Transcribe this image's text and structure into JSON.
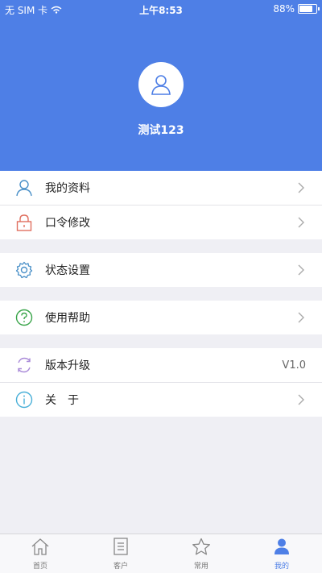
{
  "status_bar": {
    "carrier": "无 SIM 卡",
    "time": "上午8:53",
    "battery": "88%",
    "battery_level": 0.88
  },
  "profile": {
    "name": "测试123"
  },
  "menu": {
    "profile_label": "我的资料",
    "password_label": "口令修改",
    "status_label": "状态设置",
    "help_label": "使用帮助",
    "upgrade_label": "版本升级",
    "upgrade_value": "V1.0",
    "about_label": "关　于"
  },
  "tabs": [
    {
      "label": "首页",
      "icon": "home-icon"
    },
    {
      "label": "客户",
      "icon": "document-icon"
    },
    {
      "label": "常用",
      "icon": "star-icon"
    },
    {
      "label": "我的",
      "icon": "user-icon",
      "active": true
    }
  ],
  "colors": {
    "accent": "#4e7fe6",
    "background": "#efeff4"
  }
}
